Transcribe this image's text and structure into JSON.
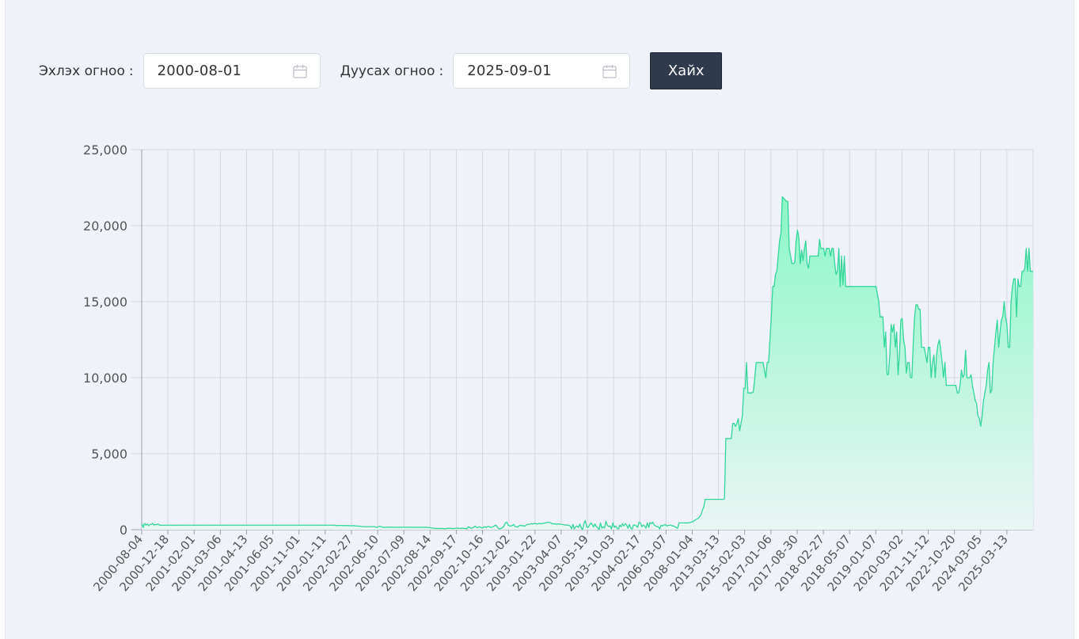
{
  "filters": {
    "start_label": "Эхлэх огноо",
    "start_value": "2000-08-01",
    "end_label": "Дуусах огноо",
    "end_value": "2025-09-01",
    "colon": ":",
    "search_button": "Хайх"
  },
  "colors": {
    "line": "#33d69a",
    "fill_top": "#8bf7c8",
    "fill_bottom": "#e9f6f4",
    "button_bg": "#2f3a4d",
    "panel_bg": "#eff3f9"
  },
  "chart_data": {
    "type": "area",
    "title": "",
    "xlabel": "",
    "ylabel": "",
    "ylim": [
      0,
      25000
    ],
    "y_ticks": [
      0,
      5000,
      10000,
      15000,
      20000,
      25000
    ],
    "y_tick_labels": [
      "0",
      "5,000",
      "10,000",
      "15,000",
      "20,000",
      "25,000"
    ],
    "x_tick_labels": [
      "2000-08-04",
      "2000-12-18",
      "2001-02-01",
      "2001-03-06",
      "2001-04-13",
      "2001-06-05",
      "2001-11-01",
      "2002-01-11",
      "2002-02-27",
      "2002-06-10",
      "2002-07-09",
      "2002-08-14",
      "2002-09-17",
      "2002-10-16",
      "2002-12-02",
      "2003-01-22",
      "2003-04-07",
      "2003-05-19",
      "2003-10-03",
      "2004-02-17",
      "2006-03-07",
      "2008-01-04",
      "2013-03-13",
      "2015-02-03",
      "2017-01-06",
      "2017-08-30",
      "2018-02-27",
      "2018-05-07",
      "2019-01-07",
      "2020-03-02",
      "2021-11-12",
      "2022-10-20",
      "2024-03-05",
      "2025-03-13"
    ],
    "grid": true,
    "x_axis_note": "category axis; points spaced evenly; first point 2000-08-04, last point 2025-09-01",
    "series": [
      {
        "values": [
          400,
          150,
          420,
          300,
          380,
          260,
          330,
          350,
          420,
          300,
          350,
          330,
          380,
          290,
          300,
          290,
          300,
          300,
          300,
          300,
          300,
          300,
          300,
          300,
          290,
          290,
          300,
          300,
          290,
          300,
          300,
          300,
          300,
          300,
          300,
          300,
          300,
          300,
          300,
          300,
          300,
          290,
          300,
          300,
          300,
          300,
          300,
          300,
          300,
          300,
          300,
          290,
          300,
          300,
          300,
          300,
          300,
          300,
          300,
          290,
          300,
          300,
          300,
          300,
          300,
          300,
          300,
          300,
          300,
          300,
          300,
          300,
          300,
          300,
          300,
          300,
          300,
          300,
          300,
          300,
          300,
          300,
          300,
          300,
          300,
          300,
          300,
          300,
          300,
          300,
          300,
          300,
          300,
          300,
          300,
          300,
          300,
          300,
          300,
          300,
          300,
          300,
          300,
          300,
          300,
          300,
          300,
          300,
          300,
          300,
          300,
          300,
          300,
          300,
          300,
          300,
          300,
          300,
          300,
          300,
          300,
          300,
          300,
          300,
          300,
          300,
          300,
          300,
          300,
          300,
          290,
          300,
          300,
          300,
          300,
          300,
          300,
          300,
          300,
          300,
          290,
          280,
          270,
          280,
          280,
          280,
          270,
          270,
          270,
          280,
          270,
          270,
          260,
          260,
          270,
          250,
          240,
          240,
          230,
          220,
          210,
          200,
          200,
          200,
          200,
          200,
          200,
          200,
          200,
          200,
          180,
          150,
          220,
          220,
          200,
          160,
          160,
          160,
          160,
          180,
          160,
          170,
          160,
          170,
          160,
          160,
          160,
          170,
          160,
          170,
          160,
          170,
          160,
          170,
          160,
          170,
          170,
          160,
          160,
          160,
          160,
          160,
          160,
          160,
          160,
          160,
          160,
          160,
          150,
          140,
          120,
          110,
          100,
          80,
          80,
          80,
          80,
          80,
          80,
          80,
          60,
          80,
          100,
          90,
          100,
          80,
          80,
          80,
          100,
          100,
          100,
          80,
          100,
          100,
          80,
          80,
          60,
          200,
          150,
          100,
          120,
          160,
          250,
          150,
          130,
          200,
          150,
          120,
          150,
          200,
          150,
          200,
          220,
          150,
          160,
          200,
          250,
          300,
          200,
          80,
          50,
          100,
          150,
          250,
          450,
          500,
          300,
          250,
          250,
          280,
          350,
          200,
          200,
          180,
          260,
          300,
          250,
          280,
          230,
          300,
          350,
          350,
          380,
          400,
          380,
          420,
          400,
          380,
          400,
          420,
          380,
          430,
          420,
          450,
          470,
          500,
          470,
          450,
          400,
          380,
          400,
          350,
          380,
          380,
          360,
          350,
          340,
          320,
          300,
          310,
          290,
          250,
          60,
          350,
          50,
          200,
          250,
          150,
          380,
          130,
          0,
          400,
          600,
          180,
          150,
          300,
          450,
          350,
          180,
          380,
          200,
          150,
          0,
          450,
          100,
          200,
          120,
          550,
          300,
          200,
          250,
          50,
          450,
          150,
          250,
          100,
          50,
          300,
          200,
          400,
          250,
          400,
          300,
          100,
          350,
          100,
          50,
          320,
          300,
          250,
          150,
          500,
          450,
          200,
          300,
          250,
          100,
          450,
          150,
          480,
          400,
          500,
          300,
          250,
          200,
          200,
          50,
          300,
          250,
          300,
          350,
          250,
          280,
          300,
          300,
          250,
          250,
          200,
          150,
          100,
          450,
          450,
          450,
          450,
          450,
          450,
          450,
          450,
          480,
          500,
          520,
          600,
          650,
          700,
          750,
          850,
          1000,
          1300,
          1500,
          2000,
          2000,
          2000,
          2000,
          2000,
          2000,
          2000,
          2000,
          2000,
          2000,
          2000,
          2000,
          2000,
          2000,
          2050,
          6000,
          6000,
          6000,
          6000,
          6000,
          7000,
          7000,
          6800,
          7000,
          7300,
          6500,
          7000,
          7500,
          9300,
          9300,
          11000,
          9000,
          9000,
          9000,
          9000,
          9100,
          10000,
          11000,
          11000,
          11000,
          11000,
          11000,
          11000,
          10500,
          10000,
          11000,
          11000,
          12500,
          14000,
          16000,
          16000,
          16800,
          17000,
          18000,
          19000,
          19500,
          21900,
          21800,
          21700,
          21600,
          21600,
          18500,
          18000,
          17500,
          17500,
          17600,
          19000,
          19700,
          19200,
          17500,
          18400,
          17700,
          18500,
          19000,
          17500,
          17200,
          18000,
          18000,
          18000,
          18000,
          18000,
          18000,
          18000,
          19100,
          18500,
          18500,
          18500,
          18000,
          18500,
          18500,
          18500,
          18000,
          18500,
          18500,
          17500,
          16800,
          17000,
          18500,
          16000,
          18000,
          16100,
          18000,
          16000,
          16000,
          16000,
          16000,
          16000,
          16000,
          16000,
          16000,
          16000,
          16000,
          16000,
          16000,
          16000,
          16000,
          16000,
          16000,
          16000,
          16000,
          16000,
          16000,
          16000,
          16000,
          16000,
          15500,
          15000,
          14000,
          14000,
          14000,
          12000,
          13000,
          10200,
          10200,
          11500,
          13500,
          13000,
          13500,
          12000,
          13000,
          10200,
          11500,
          13800,
          13900,
          12500,
          12000,
          10300,
          11000,
          11000,
          10000,
          10000,
          12200,
          14000,
          14800,
          14800,
          14500,
          14500,
          12000,
          12000,
          12000,
          11500,
          11000,
          12000,
          12000,
          10000,
          11000,
          11500,
          10000,
          11500,
          12200,
          12500,
          11800,
          11000,
          10000,
          11000,
          9500,
          9500,
          9500,
          9500,
          9500,
          9500,
          9500,
          9500,
          9000,
          9000,
          9500,
          10500,
          10000,
          10200,
          11800,
          10000,
          10000,
          10000,
          10200,
          9500,
          9000,
          8500,
          8300,
          7500,
          7300,
          6800,
          7500,
          8500,
          9000,
          9500,
          10500,
          11000,
          9000,
          9200,
          11000,
          12000,
          13000,
          13800,
          12000,
          13000,
          13800,
          14000,
          15000,
          14000,
          13500,
          12000,
          12000,
          15000,
          16000,
          16500,
          16500,
          14000,
          16500,
          16000,
          16000,
          17000,
          17000,
          17200,
          18500,
          17000,
          18500,
          17000,
          17000,
          17000
        ]
      }
    ]
  }
}
